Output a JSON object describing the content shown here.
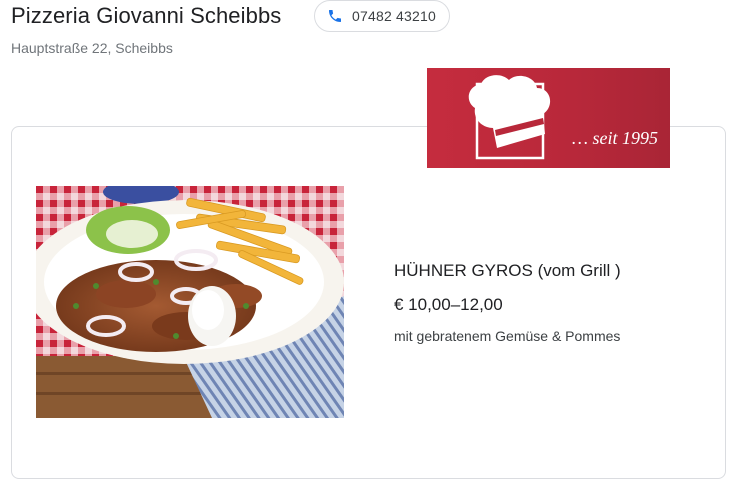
{
  "business": {
    "name": "Pizzeria Giovanni Scheibbs",
    "phone": "07482 43210",
    "address": "Hauptstraße 22, Scheibbs"
  },
  "logo": {
    "icon": "chef-hat-icon",
    "tagline": "… seit 1995",
    "color": "#b8283a"
  },
  "menu_item": {
    "image_icon": "gyros-plate-photo",
    "name": "HÜHNER GYROS (vom Grill )",
    "price": "€ 10,00–12,00",
    "description": "mit gebratenem Gemüse & Pommes"
  },
  "colors": {
    "phone_icon": "#1a73e8",
    "card_border": "#dadce0",
    "secondary_text": "#70757a"
  }
}
